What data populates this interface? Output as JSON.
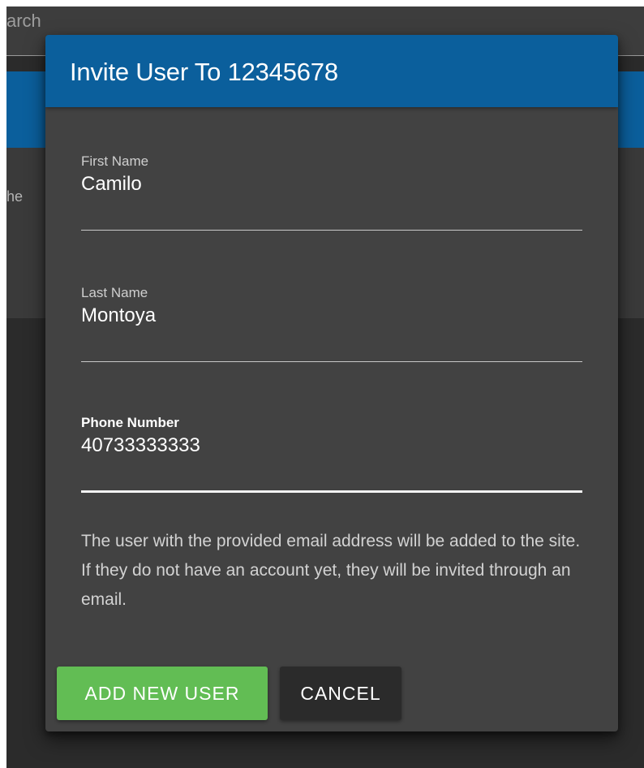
{
  "background": {
    "search_text": "arch",
    "panel_text": "he"
  },
  "dialog": {
    "title": "Invite User To 12345678",
    "fields": [
      {
        "label": "First Name",
        "value": "Camilo"
      },
      {
        "label": "Last Name",
        "value": "Montoya"
      },
      {
        "label": "Phone Number",
        "value": "40733333333"
      }
    ],
    "info_text": "The user with the provided email address will be added to the site. If they do not have an account yet, they will be invited through an email.",
    "buttons": {
      "primary": "ADD NEW USER",
      "secondary": "CANCEL"
    }
  },
  "colors": {
    "header": "#0b5f9c",
    "dialog_bg": "#424242",
    "primary_button": "#62bd54",
    "secondary_button": "#2b2b2b"
  }
}
